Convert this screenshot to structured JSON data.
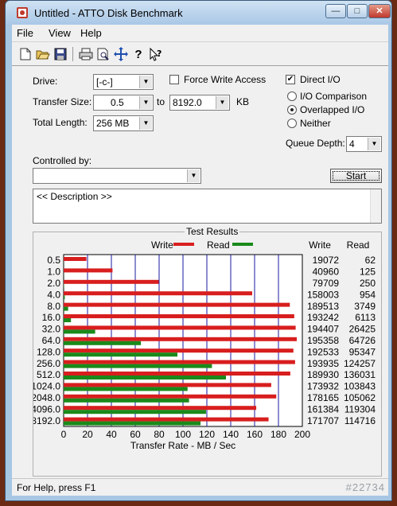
{
  "window": {
    "title": "Untitled - ATTO Disk Benchmark"
  },
  "menu": [
    "File",
    "View",
    "Help"
  ],
  "toolbar_icons": [
    "new-icon",
    "open-icon",
    "save-icon",
    "print-icon",
    "print-preview-icon",
    "move-icon",
    "help-icon",
    "context-help-icon"
  ],
  "form": {
    "drive_label": "Drive:",
    "drive_value": "[-c-]",
    "transfer_size_label": "Transfer Size:",
    "transfer_from": "0.5",
    "to_label": "to",
    "transfer_to": "8192.0",
    "kb_label": "KB",
    "total_length_label": "Total Length:",
    "total_length_value": "256 MB",
    "force_write_label": "Force Write Access",
    "force_write_checked": false,
    "direct_io_label": "Direct I/O",
    "direct_io_checked": true,
    "io_comparison_label": "I/O Comparison",
    "overlapped_io_label": "Overlapped I/O",
    "neither_label": "Neither",
    "selected_mode": "Overlapped I/O",
    "queue_depth_label": "Queue Depth:",
    "queue_depth_value": "4",
    "controlled_by_label": "Controlled by:",
    "controlled_by_value": "",
    "start_label": "Start",
    "description": "<< Description >>"
  },
  "results": {
    "group_title": "Test Results",
    "write_legend": "Write",
    "read_legend": "Read",
    "write_col": "Write",
    "read_col": "Read"
  },
  "colors": {
    "write": "#d81e1e",
    "read": "#1a8a1a"
  },
  "chart_data": {
    "type": "bar",
    "orientation": "horizontal",
    "title": "Test Results",
    "xlabel": "Transfer Rate - MB / Sec",
    "xlim": [
      0,
      200
    ],
    "xticks": [
      0,
      20,
      40,
      60,
      80,
      100,
      120,
      140,
      160,
      180,
      200
    ],
    "categories": [
      "0.5",
      "1.0",
      "2.0",
      "4.0",
      "8.0",
      "16.0",
      "32.0",
      "64.0",
      "128.0",
      "256.0",
      "512.0",
      "1024.0",
      "2048.0",
      "4096.0",
      "8192.0"
    ],
    "series": [
      {
        "name": "Write",
        "values": [
          19072,
          40960,
          79709,
          158003,
          189513,
          193242,
          194407,
          195358,
          192533,
          193935,
          189930,
          173932,
          178165,
          161384,
          171707
        ]
      },
      {
        "name": "Read",
        "values": [
          62,
          125,
          250,
          954,
          3749,
          6113,
          26425,
          64726,
          95347,
          124257,
          136031,
          103843,
          105062,
          119304,
          114716
        ]
      }
    ],
    "value_scale": 1000,
    "grid": true,
    "legend": "top"
  },
  "status": {
    "help_text": "For Help, press F1",
    "watermark": "#22734"
  }
}
